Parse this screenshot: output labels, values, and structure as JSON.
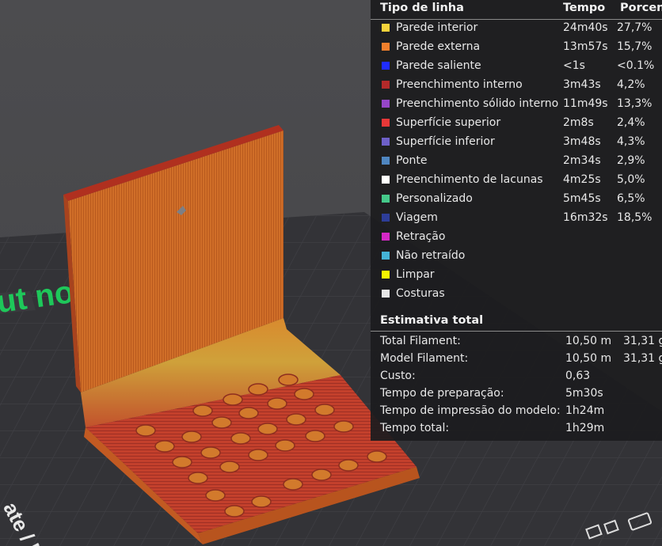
{
  "legend": {
    "headers": {
      "type": "Tipo de linha",
      "time": "Tempo",
      "percent": "Porcent"
    },
    "rows": [
      {
        "label": "Parede interior",
        "time": "24m40s",
        "percent": "27,7%",
        "color": "#f5d33b"
      },
      {
        "label": "Parede externa",
        "time": "13m57s",
        "percent": "15,7%",
        "color": "#f07f2c"
      },
      {
        "label": "Parede saliente",
        "time": "<1s",
        "percent": "<0.1%",
        "color": "#1f2cff"
      },
      {
        "label": "Preenchimento interno",
        "time": "3m43s",
        "percent": "4,2%",
        "color": "#b32a2a"
      },
      {
        "label": "Preenchimento sólido interno",
        "time": "11m49s",
        "percent": "13,3%",
        "color": "#9646c8"
      },
      {
        "label": "Superfície superior",
        "time": "2m8s",
        "percent": "2,4%",
        "color": "#e83838"
      },
      {
        "label": "Superfície inferior",
        "time": "3m48s",
        "percent": "4,3%",
        "color": "#6e60c8"
      },
      {
        "label": "Ponte",
        "time": "2m34s",
        "percent": "2,9%",
        "color": "#4f86c1"
      },
      {
        "label": "Preenchimento de lacunas",
        "time": "4m25s",
        "percent": "5,0%",
        "color": "#ffffff"
      },
      {
        "label": "Personalizado",
        "time": "5m45s",
        "percent": "6,5%",
        "color": "#45c98a"
      },
      {
        "label": "Viagem",
        "time": "16m32s",
        "percent": "18,5%",
        "color": "#2d3d98"
      },
      {
        "label": "Retração",
        "time": "",
        "percent": "",
        "color": "#d428c6"
      },
      {
        "label": "Não retraído",
        "time": "",
        "percent": "",
        "color": "#45b3d6"
      },
      {
        "label": "Limpar",
        "time": "",
        "percent": "",
        "color": "#f5f500"
      },
      {
        "label": "Costuras",
        "time": "",
        "percent": "",
        "color": "#e6e6e6"
      }
    ]
  },
  "estimate": {
    "title": "Estimativa total",
    "rows": [
      {
        "label": "Total Filament:",
        "v1": "10,50 m",
        "v2": "31,31 g"
      },
      {
        "label": "Model Filament:",
        "v1": "10,50 m",
        "v2": "31,31 g"
      },
      {
        "label": "Custo:",
        "v1": "0,63",
        "v2": ""
      },
      {
        "label": "Tempo de preparação:",
        "v1": "5m30s",
        "v2": ""
      },
      {
        "label": "Tempo de impressão do modelo:",
        "v1": "1h24m",
        "v2": ""
      },
      {
        "label": "Tempo total:",
        "v1": "1h29m",
        "v2": ""
      }
    ]
  },
  "plate": {
    "watermark_text": "ut no",
    "plate_label": "ate / Hi",
    "colors": {
      "model_top": "#c8442c",
      "model_back": "#d2702a",
      "plate": "#2f2f33",
      "accent_green": "#1ec85a"
    }
  }
}
